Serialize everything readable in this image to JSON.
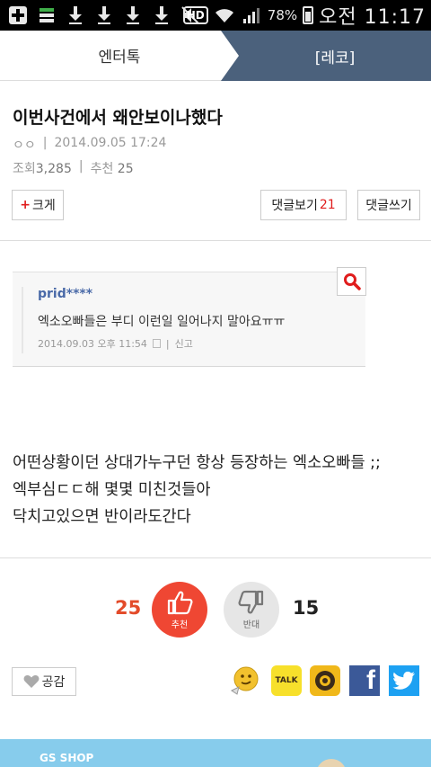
{
  "status_bar": {
    "hd": "HD",
    "battery_percent": "78%",
    "time": "오전 11:17"
  },
  "tabs": {
    "left": "엔터톡",
    "right": "[레코]"
  },
  "article": {
    "title": "이번사건에서 왜안보이나했다",
    "author": "ㅇㅇ",
    "date": "2014.09.05 17:24",
    "views_label": "조회",
    "views": "3,285",
    "recommend_label": "추천",
    "recommend": "25",
    "font_size_button": "크게",
    "comments_view_label": "댓글보기",
    "comments_count": "21",
    "comment_write_label": "댓글쓰기"
  },
  "embedded_comment": {
    "user": "prid****",
    "text": "엑소오빠들은 부디 이런일 일어나지 말아요ㅠㅠ",
    "date": "2014.09.03 오후 11:54",
    "report": "신고"
  },
  "body": {
    "line1": "어떤상황이던 상대가누구던 항상 등장하는 엑소오빠들 ;;",
    "line2": "엑부심ㄷㄷ해 몇몇 미친것들아",
    "line3": "닥치고있으면 반이라도간다"
  },
  "votes": {
    "up_count": "25",
    "up_label": "추천",
    "down_label": "반대",
    "down_count": "15"
  },
  "share": {
    "like_label": "공감",
    "talk_label": "TALK",
    "facebook_glyph": "f"
  },
  "ad": {
    "brand": "GS SHOP"
  },
  "colors": {
    "tab_active_bg": "#4b617c",
    "accent_red": "#e01d1d",
    "vote_up_bg": "#ef4733",
    "facebook": "#3b5998",
    "twitter": "#1da1f2",
    "kakao": "#f7e02b"
  }
}
